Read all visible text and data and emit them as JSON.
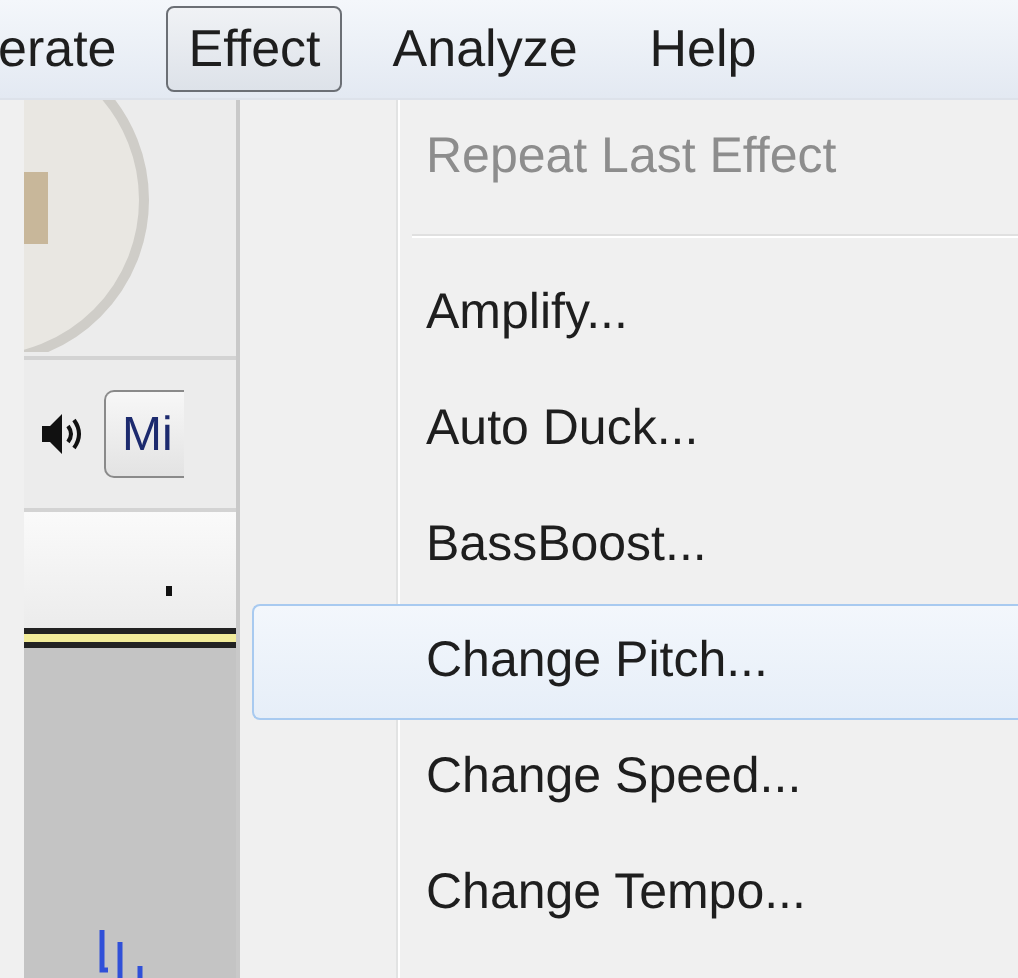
{
  "menubar": [
    {
      "label": "erate",
      "selected": false
    },
    {
      "label": "Effect",
      "selected": true
    },
    {
      "label": "Analyze",
      "selected": false
    },
    {
      "label": "Help",
      "selected": false
    }
  ],
  "toolbar": {
    "device_field": "Mi"
  },
  "menu": {
    "items": [
      {
        "kind": "item",
        "label": "Repeat Last Effect",
        "disabled": true,
        "selected": false
      },
      {
        "kind": "separator"
      },
      {
        "kind": "item",
        "label": "Amplify...",
        "disabled": false,
        "selected": false
      },
      {
        "kind": "item",
        "label": "Auto Duck...",
        "disabled": false,
        "selected": false
      },
      {
        "kind": "item",
        "label": "BassBoost...",
        "disabled": false,
        "selected": false
      },
      {
        "kind": "item",
        "label": "Change Pitch...",
        "disabled": false,
        "selected": true
      },
      {
        "kind": "item",
        "label": "Change Speed...",
        "disabled": false,
        "selected": false
      },
      {
        "kind": "item",
        "label": "Change Tempo...",
        "disabled": false,
        "selected": false
      }
    ]
  }
}
